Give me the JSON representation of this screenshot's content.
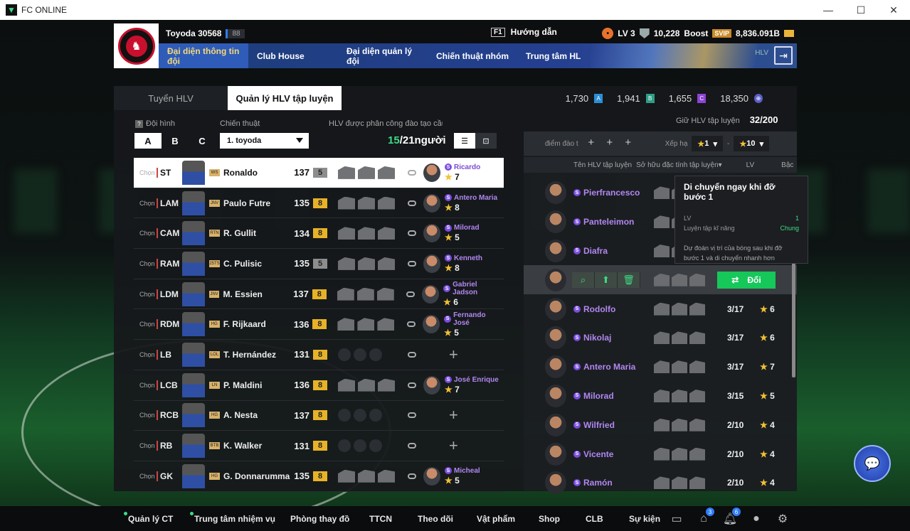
{
  "window": {
    "title": "FC ONLINE"
  },
  "header": {
    "username": "Toyoda 30568",
    "level_badge": "88",
    "guide_key": "F1",
    "guide_label": "Hướng dẫn",
    "lv": "LV 3",
    "shield_value": "10,228",
    "boost_label": "Boost",
    "svip": "SVIP",
    "bp": "8,836.091B",
    "nav": [
      "Đại diện thông tin đội",
      "Club House",
      "Đại diện quản lý đội",
      "Chiến thuật nhóm",
      "Trung tâm HL"
    ],
    "nav_small": "HLV"
  },
  "panel": {
    "tabs": [
      "Tuyển HLV",
      "Quản lý HLV tập luyện"
    ],
    "currencies": [
      {
        "value": "1,730",
        "tag": "A"
      },
      {
        "value": "1,941",
        "tag": "B"
      },
      {
        "value": "1,655",
        "tag": "C"
      },
      {
        "value": "18,350",
        "tag": "⊕"
      }
    ],
    "formation_label": "Đội hình",
    "formation_tabs": [
      "A",
      "B",
      "C"
    ],
    "tactic_label": "Chiến thuật",
    "tactic_value": "1. toyoda",
    "assign_label": "HLV được phân công đào tạo cầu thủ",
    "assign_count_used": "15",
    "assign_count_total": "/21người",
    "holder_label": "Giữ HLV tập luyện",
    "holder_count": "32/200",
    "rows": [
      {
        "chon": "Chọn",
        "pos": "ST",
        "card": "WS",
        "name": "Ronaldo",
        "ovr": "137",
        "grade": "5",
        "grade_type": "grey",
        "has_coach": true,
        "coach": "Ricardo",
        "coach_lv": "7"
      },
      {
        "chon": "Chọn",
        "pos": "LAM",
        "card": "JNV",
        "name": "Paulo Futre",
        "ovr": "135",
        "grade": "8",
        "grade_type": "gold",
        "has_coach": true,
        "coach": "Antero Maria",
        "coach_lv": "8"
      },
      {
        "chon": "Chọn",
        "pos": "CAM",
        "card": "RTN",
        "name": "R. Gullit",
        "ovr": "134",
        "grade": "8",
        "grade_type": "gold",
        "has_coach": true,
        "coach": "Milorad",
        "coach_lv": "5"
      },
      {
        "chon": "Chọn",
        "pos": "RAM",
        "card": "25TS",
        "name": "C. Pulisic",
        "ovr": "135",
        "grade": "5",
        "grade_type": "grey",
        "has_coach": true,
        "coach": "Kenneth",
        "coach_lv": "8"
      },
      {
        "chon": "Chọn",
        "pos": "LDM",
        "card": "JNV",
        "name": "M. Essien",
        "ovr": "137",
        "grade": "8",
        "grade_type": "gold",
        "has_coach": true,
        "coach": "Gabriel Jadson",
        "coach_lv": "6"
      },
      {
        "chon": "Chọn",
        "pos": "RDM",
        "card": "HG",
        "name": "F. Rijkaard",
        "ovr": "136",
        "grade": "8",
        "grade_type": "gold",
        "has_coach": true,
        "coach": "Fernando José",
        "coach_lv": "5"
      },
      {
        "chon": "Chọn",
        "pos": "LB",
        "card": "LOL",
        "name": "T. Hernández",
        "ovr": "131",
        "grade": "8",
        "grade_type": "gold",
        "has_coach": false,
        "coach": "",
        "coach_lv": ""
      },
      {
        "chon": "Chọn",
        "pos": "LCB",
        "card": "LN",
        "name": "P. Maldini",
        "ovr": "136",
        "grade": "8",
        "grade_type": "gold",
        "has_coach": true,
        "coach": "José Enrique",
        "coach_lv": "7"
      },
      {
        "chon": "Chọn",
        "pos": "RCB",
        "card": "HG",
        "name": "A. Nesta",
        "ovr": "137",
        "grade": "8",
        "grade_type": "gold",
        "has_coach": false,
        "coach": "",
        "coach_lv": ""
      },
      {
        "chon": "Chọn",
        "pos": "RB",
        "card": "BTB",
        "name": "K. Walker",
        "ovr": "131",
        "grade": "8",
        "grade_type": "gold",
        "has_coach": false,
        "coach": "",
        "coach_lv": ""
      },
      {
        "chon": "Chọn",
        "pos": "GK",
        "card": "HG",
        "name": "G. Donnarumma",
        "ovr": "135",
        "grade": "8",
        "grade_type": "gold",
        "has_coach": true,
        "coach": "Micheal",
        "coach_lv": "5"
      }
    ]
  },
  "right": {
    "filter_label": "điểm đào t",
    "rank_label": "Xếp hạ",
    "rank_min": "1",
    "rank_max": "10",
    "col_name": "Tên HLV tập luyện",
    "col_owned": "Sở hữu đặc tính tập luyện",
    "col_lv": "LV",
    "col_grade": "Bậc",
    "action_label": "Đổi",
    "coaches": [
      {
        "name": "Pierfrancesco",
        "lv": "",
        "star": ""
      },
      {
        "name": "Panteleimon",
        "lv": "",
        "star": ""
      },
      {
        "name": "Diafra",
        "lv": "",
        "star": ""
      },
      {
        "name": "",
        "lv": "",
        "star": "",
        "highlight": true
      },
      {
        "name": "Rodolfo",
        "lv": "3/17",
        "star": "6"
      },
      {
        "name": "Nikolaj",
        "lv": "3/17",
        "star": "6"
      },
      {
        "name": "Antero Maria",
        "lv": "3/17",
        "star": "7"
      },
      {
        "name": "Milorad",
        "lv": "3/15",
        "star": "5"
      },
      {
        "name": "Wilfried",
        "lv": "2/10",
        "star": "4"
      },
      {
        "name": "Vicente",
        "lv": "2/10",
        "star": "4"
      },
      {
        "name": "Ramón",
        "lv": "2/10",
        "star": "4"
      }
    ]
  },
  "tooltip": {
    "title": "Di chuyển ngay khi đỡ bước 1",
    "lv_label": "LV",
    "lv_value": "1",
    "type_label": "Luyện tập kĩ năng",
    "type_value": "Chung",
    "desc": "Dự đoán vị trí của bóng sau khi đỡ bước 1 và di chuyển nhanh hơn"
  },
  "bottom": {
    "items": [
      "Quản lý CT",
      "Trung tâm nhiệm vụ",
      "Phòng thay đồ",
      "TTCN",
      "Theo dõi",
      "Vật phẩm",
      "Shop",
      "CLB",
      "Sự kiện"
    ],
    "badge_home": "3",
    "badge_bell": "6"
  }
}
